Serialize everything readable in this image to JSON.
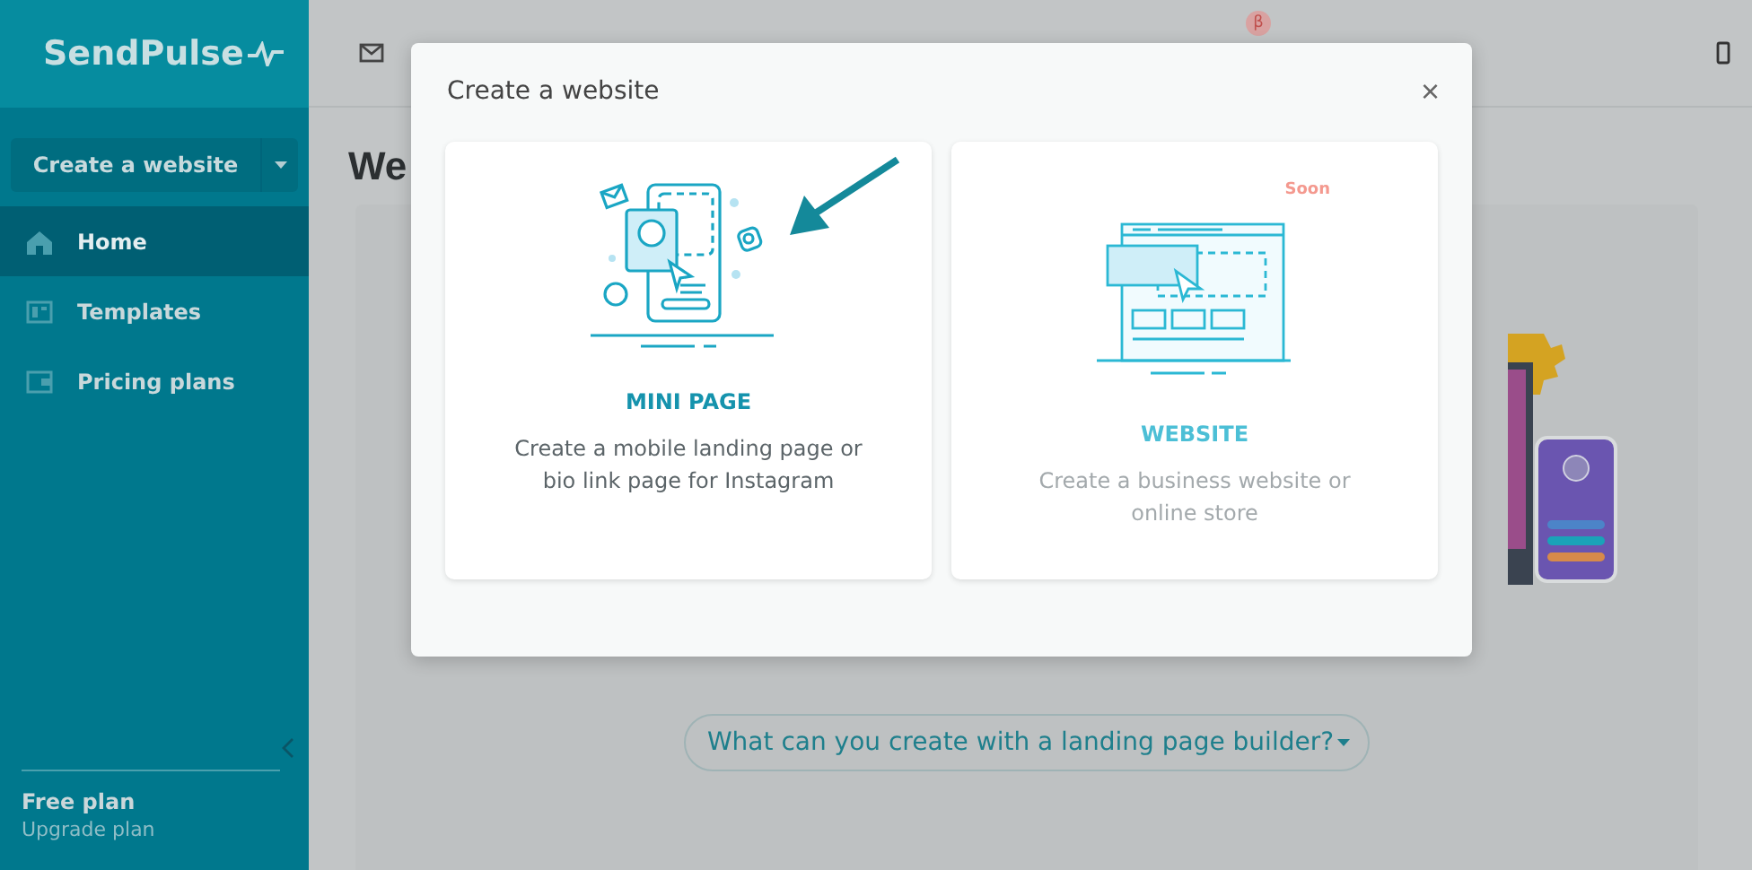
{
  "sidebar": {
    "logo": "SendPulse",
    "create_button": {
      "label": "Create a website"
    },
    "items": [
      {
        "label": "Home",
        "selected": true
      },
      {
        "label": "Templates",
        "selected": false
      },
      {
        "label": "Pricing plans",
        "selected": false
      }
    ],
    "plan": {
      "name": "Free plan",
      "link": "Upgrade plan"
    }
  },
  "topbar": {
    "badge": "β"
  },
  "page": {
    "heading": "We",
    "help_button": "What can you create with a landing page builder?"
  },
  "dialog": {
    "title": "Create a website",
    "close": "×",
    "options": [
      {
        "kind": "mini_page",
        "title": "MINI PAGE",
        "description": "Create a mobile landing page or bio link page for Instagram",
        "disabled": false
      },
      {
        "kind": "website",
        "title": "WEBSITE",
        "description": "Create a business website or online store",
        "badge": "Soon",
        "disabled": true
      }
    ]
  }
}
